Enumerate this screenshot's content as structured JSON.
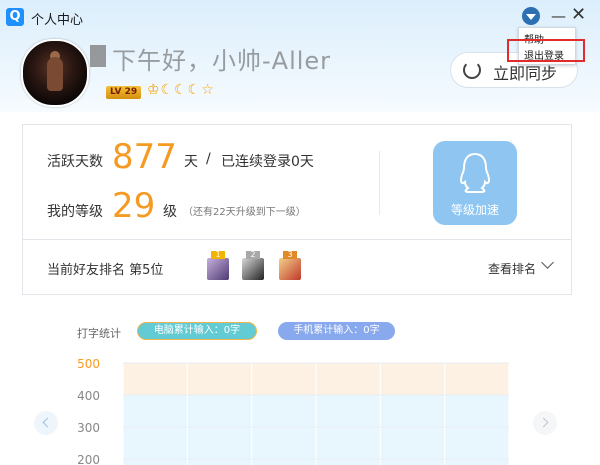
{
  "window": {
    "title": "个人中心",
    "logo_text": "Q",
    "icons": {
      "menu": "dropdown-arrow-icon",
      "minimize": "minimize-icon",
      "close": "close-icon"
    }
  },
  "menu": {
    "items": [
      {
        "label": "帮助"
      },
      {
        "label": "退出登录"
      }
    ],
    "highlight_color": "#e02c2c"
  },
  "profile": {
    "nickname": "下午好，小帅-Allen",
    "level_badge": "LV 29",
    "level_icons": "♔☾☾☾☆"
  },
  "sync": {
    "label": "立即同步"
  },
  "stats": {
    "active_label": "活跃天数",
    "active_days": "877",
    "active_unit": "天",
    "separator": "/",
    "streak_text": "已连续登录0天",
    "level_label": "我的等级",
    "level_value": "29",
    "level_unit": "级",
    "level_note": "（还有22天升级到下一级）",
    "speedup_label": "等级加速"
  },
  "ranking": {
    "label": "当前好友排名 第5位",
    "view_label": "查看排名",
    "friends": [
      {
        "rank": "1",
        "crown_color": "#f2b400"
      },
      {
        "rank": "2",
        "crown_color": "#a8a8a8"
      },
      {
        "rank": "3",
        "crown_color": "#e08a2a"
      }
    ]
  },
  "typing": {
    "title": "打字统计",
    "pc_label": "电脑累计输入：0字",
    "mobile_label": "手机累计输入：0字"
  },
  "chart_data": {
    "type": "area",
    "yticks": [
      500,
      400,
      300,
      200
    ],
    "ylim": [
      200,
      500
    ],
    "highlight_tick": 500,
    "series": [
      {
        "values": [
          0,
          0,
          0,
          0,
          0,
          0
        ]
      }
    ],
    "bands": [
      {
        "from": 400,
        "to": 500,
        "color": "#fdf1e3"
      },
      {
        "from": 200,
        "to": 400,
        "color": "#e8f6fe"
      }
    ],
    "tick_colors": {
      "highlight": "#f59a23",
      "normal": "#888888"
    }
  },
  "colors": {
    "accent": "#f59a23",
    "brand": "#1e90ff",
    "speedup": "#8fc6f1"
  }
}
